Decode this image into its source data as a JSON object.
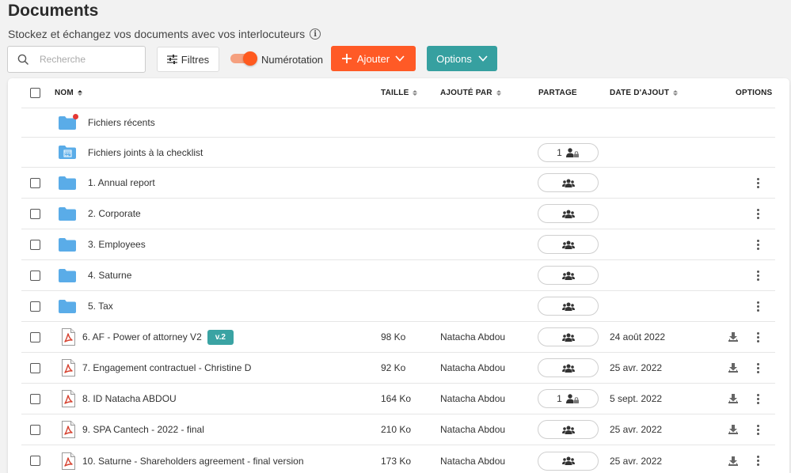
{
  "page": {
    "title": "Documents",
    "subtitle": "Stockez et échangez vos documents avec vos interlocuteurs",
    "info_icon": "i"
  },
  "toolbar": {
    "search_placeholder": "Recherche",
    "filters_label": "Filtres",
    "numbering_label": "Numérotation",
    "numbering_enabled": true,
    "add_label": "Ajouter",
    "options_label": "Options"
  },
  "colors": {
    "accent_orange": "#ff5a26",
    "accent_teal": "#36a0a0",
    "folder_blue": "#5aace8",
    "pdf_red": "#d6412f"
  },
  "table": {
    "columns": {
      "name": "NOM",
      "size": "TAILLE",
      "added_by": "AJOUTÉ PAR",
      "share": "PARTAGE",
      "date": "DATE D'AJOUT",
      "options": "OPTIONS"
    },
    "rows": [
      {
        "type": "folder-recent",
        "icon": "folder-icon",
        "name": "Fichiers récents",
        "checkbox": false,
        "share": null,
        "size": "",
        "added_by": "",
        "date": "",
        "download": false,
        "menu": false
      },
      {
        "type": "folder-checklist",
        "icon": "checklist-folder-icon",
        "name": "Fichiers joints à la checklist",
        "checkbox": false,
        "share": {
          "kind": "restricted",
          "count": "1"
        },
        "size": "",
        "added_by": "",
        "date": "",
        "download": false,
        "menu": false
      },
      {
        "type": "folder",
        "icon": "folder-icon",
        "name": "1. Annual report",
        "checkbox": true,
        "share": {
          "kind": "group",
          "count": ""
        },
        "size": "",
        "added_by": "",
        "date": "",
        "download": false,
        "menu": true
      },
      {
        "type": "folder",
        "icon": "folder-icon",
        "name": "2. Corporate",
        "checkbox": true,
        "share": {
          "kind": "group",
          "count": ""
        },
        "size": "",
        "added_by": "",
        "date": "",
        "download": false,
        "menu": true
      },
      {
        "type": "folder",
        "icon": "folder-icon",
        "name": "3. Employees",
        "checkbox": true,
        "share": {
          "kind": "group",
          "count": ""
        },
        "size": "",
        "added_by": "",
        "date": "",
        "download": false,
        "menu": true
      },
      {
        "type": "folder",
        "icon": "folder-icon",
        "name": "4. Saturne",
        "checkbox": true,
        "share": {
          "kind": "group",
          "count": ""
        },
        "size": "",
        "added_by": "",
        "date": "",
        "download": false,
        "menu": true
      },
      {
        "type": "folder",
        "icon": "folder-icon",
        "name": "5. Tax",
        "checkbox": true,
        "share": {
          "kind": "group",
          "count": ""
        },
        "size": "",
        "added_by": "",
        "date": "",
        "download": false,
        "menu": true
      },
      {
        "type": "pdf",
        "icon": "pdf-file-icon",
        "name": "6. AF - Power of attorney V2",
        "version": "v.2",
        "checkbox": true,
        "share": {
          "kind": "group",
          "count": ""
        },
        "size": "98 Ko",
        "added_by": "Natacha Abdou",
        "date": "24 août 2022",
        "download": true,
        "menu": true
      },
      {
        "type": "pdf",
        "icon": "pdf-file-icon",
        "name": "7. Engagement contractuel - Christine D",
        "checkbox": true,
        "share": {
          "kind": "group",
          "count": ""
        },
        "size": "92 Ko",
        "added_by": "Natacha Abdou",
        "date": "25 avr. 2022",
        "download": true,
        "menu": true
      },
      {
        "type": "pdf",
        "icon": "pdf-file-icon",
        "name": "8. ID Natacha ABDOU",
        "checkbox": true,
        "share": {
          "kind": "restricted",
          "count": "1"
        },
        "size": "164 Ko",
        "added_by": "Natacha Abdou",
        "date": "5 sept. 2022",
        "download": true,
        "menu": true
      },
      {
        "type": "pdf",
        "icon": "pdf-file-icon",
        "name": "9. SPA Cantech - 2022 - final",
        "checkbox": true,
        "share": {
          "kind": "group",
          "count": ""
        },
        "size": "210 Ko",
        "added_by": "Natacha Abdou",
        "date": "25 avr. 2022",
        "download": true,
        "menu": true
      },
      {
        "type": "pdf",
        "icon": "pdf-file-icon",
        "name": "10. Saturne - Shareholders agreement - final version",
        "checkbox": true,
        "share": {
          "kind": "group",
          "count": ""
        },
        "size": "173 Ko",
        "added_by": "Natacha Abdou",
        "date": "25 avr. 2022",
        "download": true,
        "menu": true
      }
    ]
  }
}
